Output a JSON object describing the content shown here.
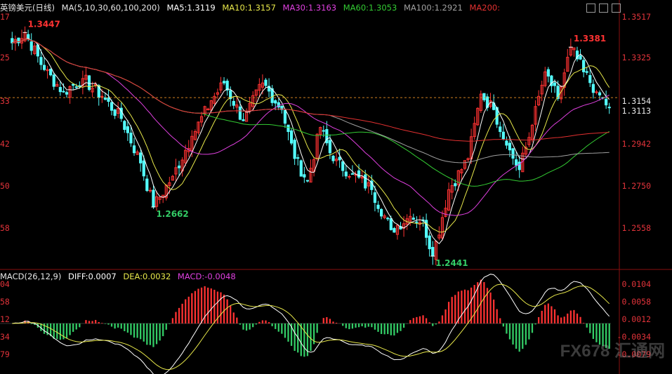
{
  "header": {
    "symbol": "英镑美元(日线)",
    "ma_label": "MA(5,10,30,60,100,200)",
    "ma5": "MA5:1.3119",
    "ma10": "MA10:1.3157",
    "ma30": "MA30:1.3163",
    "ma60": "MA60:1.3053",
    "ma100": "MA100:1.2921",
    "ma200": "MA200:"
  },
  "macd_header": {
    "label": "MACD(26,12,9)",
    "diff": "DIFF:0.0007",
    "dea": "DEA:0.0032",
    "macd": "MACD:-0.0048"
  },
  "price_axis": [
    "1.3517",
    "1.3325",
    "1.3154",
    "1.3113",
    "1.2942",
    "1.2750",
    "1.2558"
  ],
  "macd_axis": [
    "0.0104",
    "0.0058",
    "0.0012",
    "-0.0034",
    "-0.0079"
  ],
  "left_ticks": [
    "17",
    "25",
    "33",
    "42",
    "50",
    "58",
    "04",
    "58",
    "12",
    "34",
    "79"
  ],
  "annotations": {
    "high1": "1.3447",
    "low1": "1.2662",
    "low2": "1.2441",
    "high2": "1.3381"
  },
  "watermark": "FX678 汇通网",
  "colors": {
    "up": "#ff3232",
    "down": "#54ffff",
    "ma5": "#ffffff",
    "ma10": "#e8e84a",
    "ma30": "#e040e0",
    "ma60": "#33cc33",
    "ma100": "#a0a0a0",
    "ma200": "#e33030",
    "dashed": "#d08020"
  },
  "chart_data": {
    "type": "candlestick",
    "timeframe": "daily",
    "ylim": [
      1.24,
      1.353
    ],
    "macd_ylim": [
      -0.0095,
      0.0115
    ],
    "anchor_points": [
      {
        "i": 0,
        "v": 1.34
      },
      {
        "i": 4,
        "v": 1.3447
      },
      {
        "i": 10,
        "v": 1.328
      },
      {
        "i": 16,
        "v": 1.318
      },
      {
        "i": 22,
        "v": 1.324
      },
      {
        "i": 28,
        "v": 1.316
      },
      {
        "i": 34,
        "v": 1.306
      },
      {
        "i": 40,
        "v": 1.286
      },
      {
        "i": 44,
        "v": 1.2662
      },
      {
        "i": 50,
        "v": 1.28
      },
      {
        "i": 56,
        "v": 1.298
      },
      {
        "i": 62,
        "v": 1.314
      },
      {
        "i": 66,
        "v": 1.322
      },
      {
        "i": 72,
        "v": 1.305
      },
      {
        "i": 78,
        "v": 1.322
      },
      {
        "i": 84,
        "v": 1.31
      },
      {
        "i": 88,
        "v": 1.288
      },
      {
        "i": 92,
        "v": 1.278
      },
      {
        "i": 96,
        "v": 1.302
      },
      {
        "i": 100,
        "v": 1.287
      },
      {
        "i": 106,
        "v": 1.281
      },
      {
        "i": 112,
        "v": 1.274
      },
      {
        "i": 118,
        "v": 1.256
      },
      {
        "i": 124,
        "v": 1.262
      },
      {
        "i": 128,
        "v": 1.26
      },
      {
        "i": 131,
        "v": 1.2441
      },
      {
        "i": 136,
        "v": 1.274
      },
      {
        "i": 142,
        "v": 1.288
      },
      {
        "i": 146,
        "v": 1.317
      },
      {
        "i": 150,
        "v": 1.31
      },
      {
        "i": 154,
        "v": 1.294
      },
      {
        "i": 158,
        "v": 1.283
      },
      {
        "i": 162,
        "v": 1.303
      },
      {
        "i": 166,
        "v": 1.327
      },
      {
        "i": 170,
        "v": 1.315
      },
      {
        "i": 174,
        "v": 1.3381
      },
      {
        "i": 178,
        "v": 1.327
      },
      {
        "i": 182,
        "v": 1.318
      },
      {
        "i": 186,
        "v": 1.311
      }
    ]
  }
}
